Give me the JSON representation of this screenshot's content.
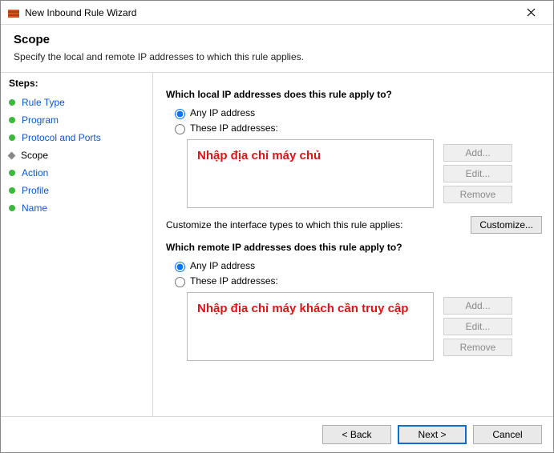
{
  "titlebar": {
    "title": "New Inbound Rule Wizard"
  },
  "header": {
    "title": "Scope",
    "description": "Specify the local and remote IP addresses to which this rule applies."
  },
  "steps": {
    "heading": "Steps:",
    "items": [
      {
        "label": "Rule Type",
        "current": false
      },
      {
        "label": "Program",
        "current": false
      },
      {
        "label": "Protocol and Ports",
        "current": false
      },
      {
        "label": "Scope",
        "current": true
      },
      {
        "label": "Action",
        "current": false
      },
      {
        "label": "Profile",
        "current": false
      },
      {
        "label": "Name",
        "current": false
      }
    ]
  },
  "local": {
    "heading": "Which local IP addresses does this rule apply to?",
    "any_label": "Any IP address",
    "these_label": "These IP addresses:",
    "annotation": "Nhập địa chỉ máy chủ",
    "buttons": {
      "add": "Add...",
      "edit": "Edit...",
      "remove": "Remove"
    }
  },
  "customize": {
    "text": "Customize the interface types to which this rule applies:",
    "button": "Customize..."
  },
  "remote": {
    "heading": "Which remote IP addresses does this rule apply to?",
    "any_label": "Any IP address",
    "these_label": "These IP addresses:",
    "annotation": "Nhập địa chỉ máy khách cần truy cập",
    "buttons": {
      "add": "Add...",
      "edit": "Edit...",
      "remove": "Remove"
    }
  },
  "footer": {
    "back": "< Back",
    "next": "Next >",
    "cancel": "Cancel"
  }
}
